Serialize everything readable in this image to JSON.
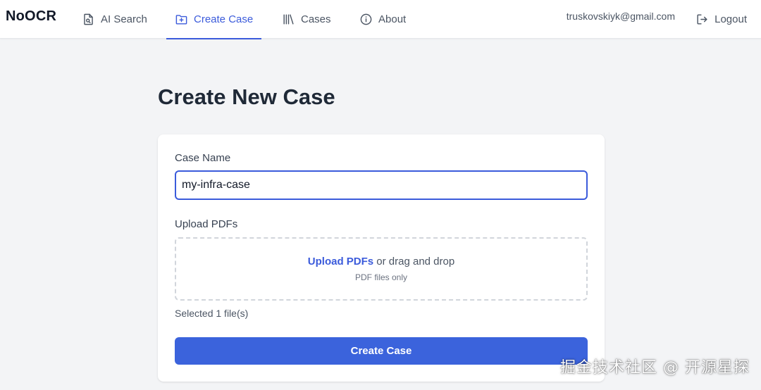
{
  "app": {
    "brand": "NoOCR"
  },
  "nav": {
    "items": [
      {
        "label": "AI Search",
        "icon": "search-document-icon",
        "active": false
      },
      {
        "label": "Create Case",
        "icon": "folder-plus-icon",
        "active": true
      },
      {
        "label": "Cases",
        "icon": "library-icon",
        "active": false
      },
      {
        "label": "About",
        "icon": "info-icon",
        "active": false
      }
    ],
    "user_email": "truskovskiyk@gmail.com",
    "logout_label": "Logout",
    "logout_icon": "logout-icon"
  },
  "page": {
    "title": "Create New Case"
  },
  "form": {
    "case_name_label": "Case Name",
    "case_name_value": "my-infra-case",
    "upload_label": "Upload PDFs",
    "dropzone": {
      "link_text": "Upload PDFs",
      "rest_text": " or drag and drop",
      "hint": "PDF files only"
    },
    "selected_status": "Selected 1 file(s)",
    "submit_label": "Create Case"
  },
  "colors": {
    "accent": "#3b5bdb",
    "button": "#3b63dc",
    "background": "#f3f4f6"
  },
  "watermark": "掘金技术社区 @ 开源星探"
}
